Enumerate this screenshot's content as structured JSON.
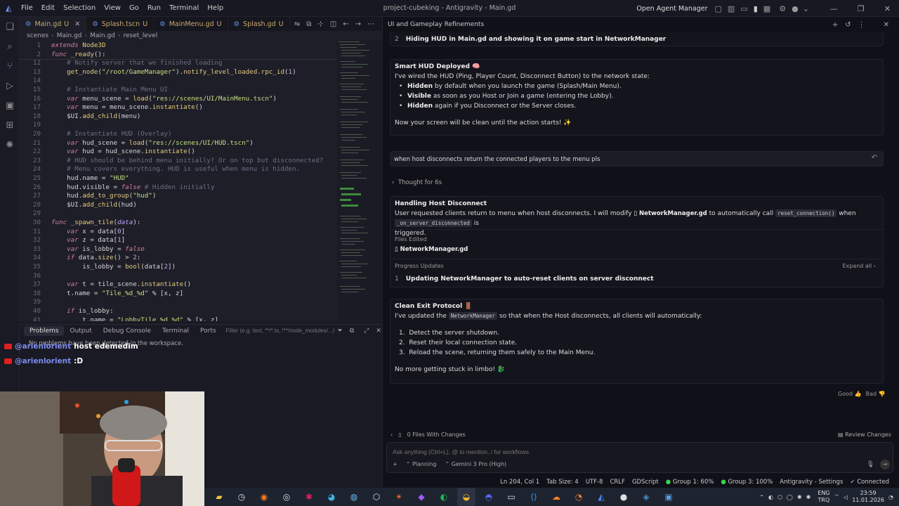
{
  "window": {
    "title": "project-cubeking - Antigravity - Main.gd",
    "open_agent_manager": "Open Agent Manager"
  },
  "menu": [
    "File",
    "Edit",
    "Selection",
    "View",
    "Go",
    "Run",
    "Terminal",
    "Help"
  ],
  "editor": {
    "tabs": [
      {
        "label": "Main.gd",
        "mod": "U",
        "active": true
      },
      {
        "label": "Splash.tscn",
        "mod": "U"
      },
      {
        "label": "MainMenu.gd",
        "mod": "U"
      },
      {
        "label": "Splash.gd",
        "mod": "U"
      }
    ],
    "breadcrumb": [
      "scenes",
      "Main.gd",
      "Main.gd",
      "reset_level"
    ],
    "lines": [
      {
        "n": "1",
        "html": "<span class='kw'>extends</span> <span class='ty'>Node3D</span>"
      },
      {
        "n": "2",
        "html": "<span class='kw'>func</span> <span class='fn'>_ready</span>():"
      },
      {
        "n": "12",
        "html": "    <span class='cm'># Notify server that we finished loading</span>"
      },
      {
        "n": "13",
        "html": "    <span class='fn'>get_node</span>(<span class='str'>\"/root/GameManager\"</span>).<span class='fn'>notify_level_loaded</span>.<span class='fn'>rpc_id</span>(<span class='num'>1</span>)"
      },
      {
        "n": "14",
        "html": ""
      },
      {
        "n": "15",
        "html": "    <span class='cm'># Instantiate Main Menu UI</span>"
      },
      {
        "n": "16",
        "html": "    <span class='kw'>var</span> menu_scene = <span class='fn'>load</span>(<span class='str'>\"res://scenes/UI/MainMenu.tscn\"</span>)"
      },
      {
        "n": "17",
        "html": "    <span class='kw'>var</span> menu = menu_scene.<span class='fn'>instantiate</span>()"
      },
      {
        "n": "18",
        "html": "    $UI.<span class='fn'>add_child</span>(menu)"
      },
      {
        "n": "19",
        "html": ""
      },
      {
        "n": "20",
        "html": "    <span class='cm'># Instantiate HUD (Overlay)</span>"
      },
      {
        "n": "21",
        "html": "    <span class='kw'>var</span> hud_scene = <span class='fn'>load</span>(<span class='str'>\"res://scenes/UI/HUD.tscn\"</span>)"
      },
      {
        "n": "22",
        "html": "    <span class='kw'>var</span> hud = hud_scene.<span class='fn'>instantiate</span>()"
      },
      {
        "n": "23",
        "html": "    <span class='cm'># HUD should be behind menu initially? Or on top but disconnected?</span>"
      },
      {
        "n": "24",
        "html": "    <span class='cm'># Menu covers everything. HUD is useful when menu is hidden.</span>"
      },
      {
        "n": "25",
        "html": "    hud.name = <span class='str'>\"HUD\"</span>"
      },
      {
        "n": "26",
        "html": "    hud.visible = <span class='kw'>false</span> <span class='cm'># Hidden initially</span>"
      },
      {
        "n": "27",
        "html": "    hud.<span class='fn'>add_to_group</span>(<span class='str'>\"hud\"</span>)"
      },
      {
        "n": "28",
        "html": "    $UI.<span class='fn'>add_child</span>(hud)"
      },
      {
        "n": "29",
        "html": ""
      },
      {
        "n": "30",
        "html": "<span class='kw'>func</span> <span class='fn'>_spawn_tile</span>(<span class='var'>data</span>):"
      },
      {
        "n": "31",
        "html": "    <span class='kw'>var</span> x = data[<span class='num'>0</span>]"
      },
      {
        "n": "32",
        "html": "    <span class='kw'>var</span> z = data[<span class='num'>1</span>]"
      },
      {
        "n": "33",
        "html": "    <span class='kw'>var</span> is_lobby = <span class='kw'>false</span>"
      },
      {
        "n": "34",
        "html": "    <span class='kw'>if</span> data.<span class='fn'>size</span>() &gt; <span class='num'>2</span>:"
      },
      {
        "n": "35",
        "html": "        is_lobby = <span class='fn'>bool</span>(data[<span class='num'>2</span>])"
      },
      {
        "n": "36",
        "html": ""
      },
      {
        "n": "37",
        "html": "    <span class='kw'>var</span> t = tile_scene.<span class='fn'>instantiate</span>()"
      },
      {
        "n": "38",
        "html": "    t.name = <span class='str'>\"Tile_%d_%d\"</span> % [x, z]"
      },
      {
        "n": "39",
        "html": ""
      },
      {
        "n": "40",
        "html": "    <span class='kw'>if</span> is_lobby:"
      },
      {
        "n": "41",
        "html": "        t.name = <span class='str'>\"LobbyTile_%d_%d\"</span> % [x, z]"
      }
    ]
  },
  "panel": {
    "tabs": [
      "Problems",
      "Output",
      "Debug Console",
      "Terminal",
      "Ports"
    ],
    "filter_placeholder": "Filter (e.g. text, **/*.ts, !**/node_modules/...)",
    "message": "No problems have been detected in the workspace."
  },
  "chat": [
    {
      "user": "@arienlorient",
      "text": "host edemedim"
    },
    {
      "user": "@arienlorient",
      "text": ":D"
    }
  ],
  "agent": {
    "title": "UI and Gameplay Refinements",
    "top_step": {
      "num": "2",
      "text": "Hiding HUD in Main.gd and showing it on game start in NetworkManager"
    },
    "smart": {
      "title": "Smart HUD Deployed 🧠",
      "intro": "I've wired the HUD (Ping, Player Count, Disconnect Button) to the network state:",
      "bullets": [
        {
          "b": "Hidden",
          "t": "by default when you launch the game (Splash/Main Menu)."
        },
        {
          "b": "Visible",
          "t": "as soon as you Host or Join a game (entering the Lobby)."
        },
        {
          "b": "Hidden",
          "t": "again if you Disconnect or the Server closes."
        }
      ],
      "outro": "Now your screen will be clean until the action starts! ✨"
    },
    "user_msg": "when host disconnects return the connected players to the menu pls",
    "thought": "Thought for 6s",
    "handling": {
      "title": "Handling Host Disconnect",
      "t1": "User requested clients return to menu when host disconnects. I will modify",
      "file": "NetworkManager.gd",
      "t2": "to automatically call",
      "code1": "reset_connection()",
      "t3": "when",
      "code2": "_on_server_disconnected",
      "t4": "is",
      "t5": "triggered.",
      "files_edited_label": "Files Edited",
      "edited_file": "NetworkManager.gd",
      "progress_label": "Progress Updates",
      "expand_all": "Expand all",
      "step_num": "1",
      "step_text": "Updating NetworkManager to auto-reset clients on server disconnect"
    },
    "clean": {
      "title": "Clean Exit Protocol 🚪",
      "t1": "I've updated the",
      "code": "NetworkManager",
      "t2": "so that when the Host disconnects, all clients will automatically:",
      "steps": [
        "Detect the server shutdown.",
        "Reset their local connection state.",
        "Reload the scene, returning them safely to the Main Menu."
      ],
      "outro": "No more getting stuck in limbo! 🐉"
    },
    "feedback": {
      "good": "Good",
      "bad": "Bad"
    },
    "files_changes": "0 Files With Changes",
    "review": "Review Changes",
    "input_placeholder": "Ask anything (Ctrl+L), @ to mention, / for workflows",
    "mode": "Planning",
    "model": "Gemini 3 Pro (High)"
  },
  "status": {
    "pos": "Ln 204, Col 1",
    "tab": "Tab Size: 4",
    "enc": "UTF-8",
    "eol": "CRLF",
    "lang": "GDScript",
    "g1": "Group 1: 60%",
    "g3": "Group 3: 100%",
    "settings": "Antigravity - Settings",
    "connected": "Connected"
  },
  "tray": {
    "lang": "ENG",
    "kb": "TRQ",
    "time": "23:59",
    "date": "11.01.2026"
  }
}
